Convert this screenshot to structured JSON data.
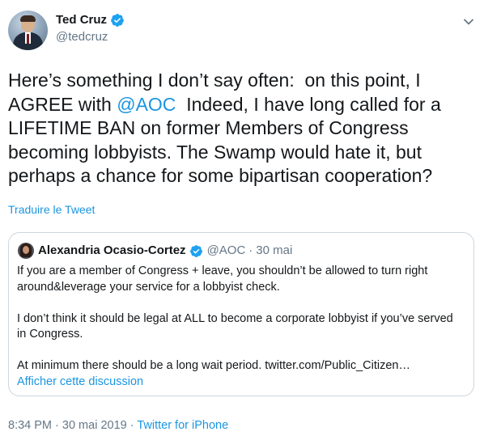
{
  "author": {
    "display_name": "Ted Cruz",
    "handle": "@tedcruz",
    "verified": true
  },
  "tweet": {
    "text_segments": [
      {
        "type": "text",
        "value": "Here’s something I don’t say often:  on this point, I AGREE with "
      },
      {
        "type": "mention",
        "value": "@AOC"
      },
      {
        "type": "text",
        "value": "  Indeed, I have long called for a LIFETIME BAN on former Members of Congress becoming lobbyists. The Swamp would hate it, but perhaps a chance for some bipartisan cooperation?"
      }
    ],
    "translate_label": "Traduire le Tweet"
  },
  "quoted_tweet": {
    "display_name": "Alexandria Ocasio-Cortez",
    "handle": "@AOC",
    "separator": "·",
    "date": "30 mai",
    "paragraphs": [
      "If you are a member of Congress + leave, you shouldn’t be allowed to turn right around&leverage your service for a lobbyist check.",
      "I don’t think it should be legal at ALL to become a corporate lobbyist if you’ve served in Congress.",
      "At minimum there should be a long wait period. twitter.com/Public_Citizen…"
    ],
    "show_thread_label": "Afficher cette discussion"
  },
  "footer": {
    "time": "8:34 PM",
    "separator_1": " · ",
    "date": "30 mai 2019",
    "separator_2": " · ",
    "source": "Twitter for iPhone"
  },
  "colors": {
    "link": "#1b95e0",
    "secondary_text": "#657786",
    "border": "#ccd6dd"
  },
  "icons": [
    "verified-badge-icon",
    "caret-down-icon"
  ]
}
